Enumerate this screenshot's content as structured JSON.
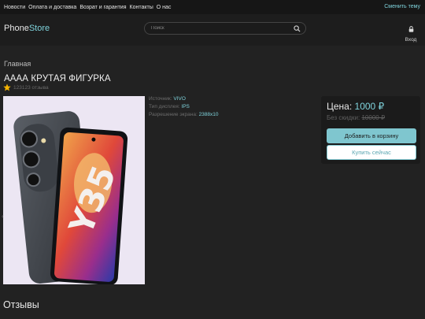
{
  "topbar": {
    "links": [
      "Новости",
      "Оплата и доставка",
      "Возрат и гарантия",
      "Контакты",
      "О нас"
    ],
    "theme_link": "Сменить тему"
  },
  "header": {
    "logo_part1": "Phone",
    "logo_part2": "Store",
    "search_placeholder": "Поиск",
    "search_icon": "magnifier-icon",
    "login_icon": "lock-icon",
    "login_label": "Вход"
  },
  "breadcrumb": "Главная",
  "product": {
    "title": "АААА КРУТАЯ ФИГУРКА",
    "rating_icon": "star-icon",
    "reviews_count": "123123 отзыва",
    "image_label": "Y35",
    "specs": [
      {
        "key": "Источник:",
        "value": "VIVO"
      },
      {
        "key": "Тип дисплея:",
        "value": "IPS"
      },
      {
        "key": "Разрешение экрана:",
        "value": "2388x10"
      }
    ]
  },
  "buy_box": {
    "price_label": "Цена:",
    "price_value": "1000 ₽",
    "old_label": "Без скидки:",
    "old_value": "10000 ₽",
    "cart_button": "Добавить в корзину",
    "buy_now_button": "Купить сейчас"
  },
  "reviews_heading": "Отзывы",
  "colors": {
    "accent": "#7fd3dc",
    "background": "#222222",
    "star": "#f5b301"
  }
}
